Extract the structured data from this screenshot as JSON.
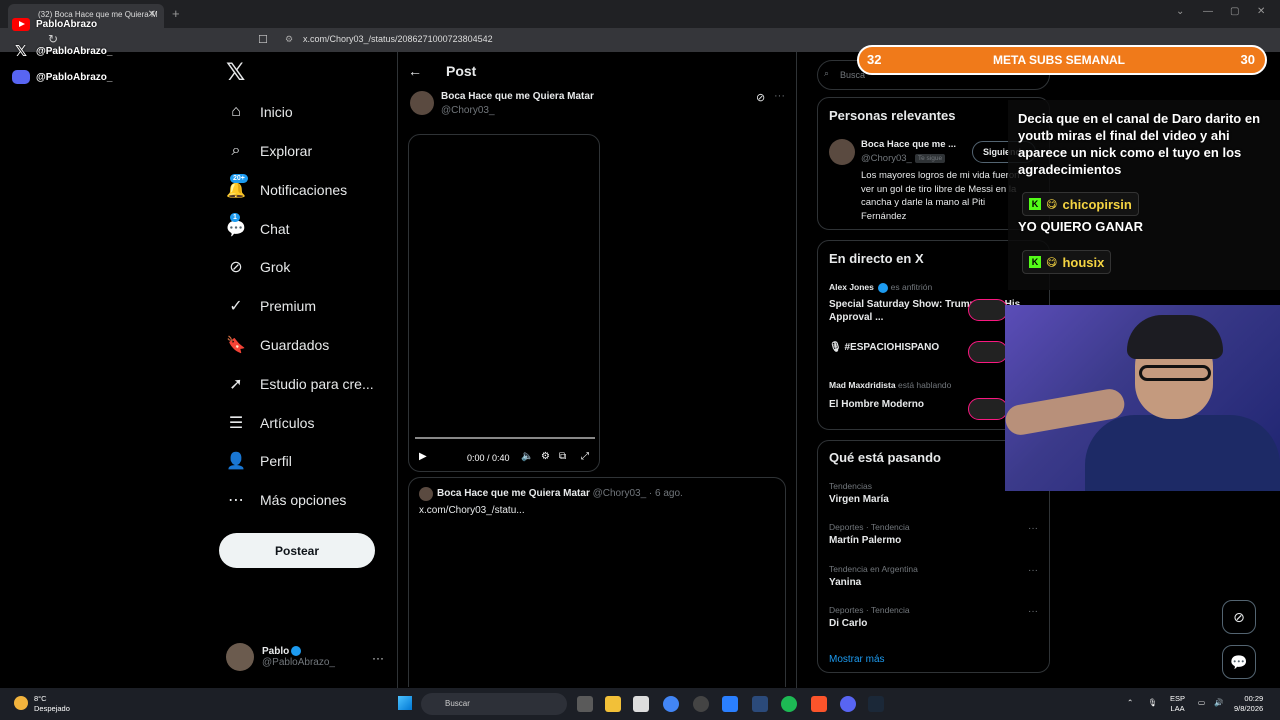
{
  "browser": {
    "tab_title": "(32) Boca Hace que me Quiera M",
    "tab_close": "✕",
    "new_tab": "+",
    "url": "x.com/Chory03_/status/2086271000723804542",
    "window_controls": [
      "⌄",
      "—",
      "▢",
      "✕"
    ]
  },
  "overlay_social": [
    {
      "icon": "youtube-icon",
      "label": "PabloAbrazo"
    },
    {
      "icon": "x-icon",
      "label": "@PabloAbrazo_"
    },
    {
      "icon": "discord-icon",
      "label": "@PabloAbrazo_"
    }
  ],
  "nav": {
    "logo": "𝕏",
    "items": [
      {
        "label": "Inicio",
        "icon": "home-icon",
        "glyph": "⌂"
      },
      {
        "label": "Explorar",
        "icon": "search-icon",
        "glyph": "⌕"
      },
      {
        "label": "Notificaciones",
        "icon": "bell-icon",
        "glyph": "🔔",
        "badge": "20+"
      },
      {
        "label": "Chat",
        "icon": "chat-icon",
        "glyph": "💬",
        "badge": "1"
      },
      {
        "label": "Grok",
        "icon": "grok-icon",
        "glyph": "⊘"
      },
      {
        "label": "Premium",
        "icon": "verified-icon",
        "glyph": "✓"
      },
      {
        "label": "Guardados",
        "icon": "bookmark-icon",
        "glyph": "🔖"
      },
      {
        "label": "Estudio para cre...",
        "icon": "rocket-icon",
        "glyph": "➚"
      },
      {
        "label": "Artículos",
        "icon": "article-icon",
        "glyph": "☰"
      },
      {
        "label": "Perfil",
        "icon": "profile-icon",
        "glyph": "👤"
      },
      {
        "label": "Más opciones",
        "icon": "more-circle-icon",
        "glyph": "⋯"
      }
    ],
    "post_button": "Postear",
    "profile_name": "Pablo",
    "profile_handle": "@PabloAbrazo_",
    "profile_more": "···"
  },
  "post": {
    "header": "Post",
    "back": "←",
    "author_name": "Boca Hace que me Quiera Matar",
    "author_handle": "@Chory03_",
    "more": "···",
    "video_time": "0:00 / 0:40",
    "video_progress": 0,
    "quote_author": "Boca Hace que me Quiera Matar",
    "quote_handle": "@Chory03_",
    "quote_date": "· 6 ago.",
    "quote_text": "x.com/Chory03_/statu..."
  },
  "sidebar": {
    "search_placeholder": "Busca",
    "relevant_title": "Personas relevantes",
    "relevant_name": "Boca Hace que me ...",
    "relevant_handle": "@Chory03_",
    "relevant_badge": "Te sigue",
    "relevant_follow": "Siguiendo",
    "relevant_bio": "Los mayores logros de mi vida fueron ver un gol de tiro libre de Messi en la cancha y darle la mano al Piti Fernández",
    "live_title": "En directo en X",
    "live": [
      {
        "host": "Alex Jones",
        "role": "es anfitrión",
        "title": "Special Saturday Show: Trump Says His Approval ..."
      },
      {
        "host": "",
        "role": "",
        "title": "#ESPACIOHISPANO"
      },
      {
        "host": "Mad Maxdridista",
        "role": "está hablando",
        "title": "El Hombre Moderno"
      }
    ],
    "trends_title": "Qué está pasando",
    "trends": [
      {
        "meta": "Tendencias",
        "name": "Virgen María"
      },
      {
        "meta": "Deportes · Tendencia",
        "name": "Martín Palermo"
      },
      {
        "meta": "Tendencia en Argentina",
        "name": "Yanina"
      },
      {
        "meta": "Deportes · Tendencia",
        "name": "Di Carlo"
      }
    ],
    "show_more": "Mostrar más"
  },
  "stream": {
    "meta_left": "32",
    "meta_center": "META SUBS SEMANAL",
    "meta_right": "30",
    "chat_message_1": "Decia que en el canal de Daro darito en youtb miras el final del video y ahi aparece un nick como el tuyo en los agradecimientos",
    "chat_user_1": "chicopirsin",
    "chat_message_2": "YO QUIERO GANAR",
    "chat_user_2": "housix",
    "kick_glyph": "K"
  },
  "taskbar": {
    "temp": "8°C",
    "weather": "Despejado",
    "search": "Buscar",
    "lang_1": "ESP",
    "lang_2": "LAA",
    "time": "00:29",
    "date": "9/8/2026"
  }
}
